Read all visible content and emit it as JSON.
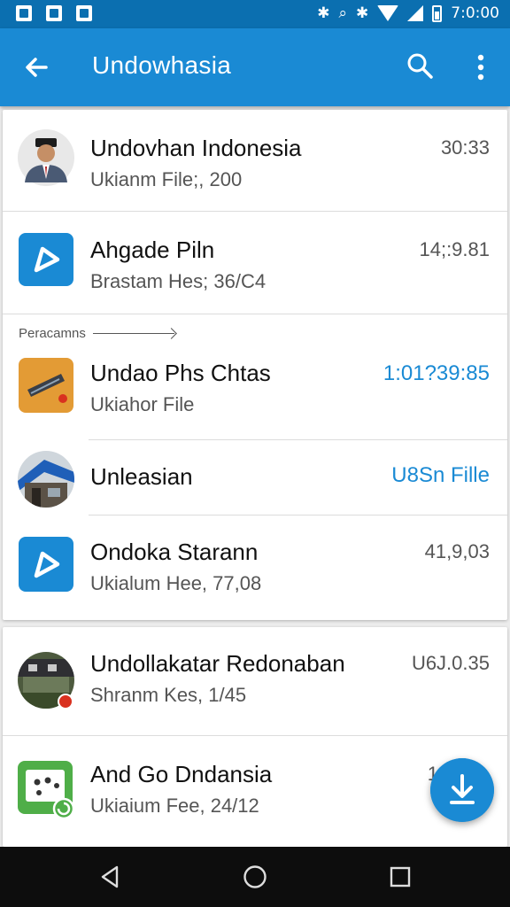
{
  "status_bar": {
    "time": "7:0:00",
    "icons": [
      "notification-icon",
      "notification-icon",
      "notification-icon",
      "bluetooth-icon",
      "vibrate-icon",
      "bluetooth-icon",
      "wifi-icon",
      "signal-icon",
      "battery-icon"
    ]
  },
  "app_bar": {
    "title": "Undowhasia",
    "back_icon": "arrow-back-icon",
    "search_icon": "search-icon",
    "more_icon": "more-vert-icon"
  },
  "colors": {
    "primary": "#1a8ad4",
    "status_bar": "#0b6fb0",
    "accent_text": "#1a8ad4"
  },
  "section_label": "Peracamns",
  "conversations": [
    {
      "name": "Undovhan Indonesia",
      "subtitle": "Ukianm File;, 200",
      "time": "30:33",
      "avatar": "person-photo"
    },
    {
      "name": "Ahgade Piln",
      "subtitle": "Brastam Hes; 36/C4",
      "time": "14;:9.81",
      "avatar": "blue-app-icon"
    },
    {
      "name": "Undao Phs Chtas",
      "subtitle": "Ukiahor File",
      "time": "1:01?39:85",
      "avatar": "orange-app-icon",
      "time_accent": true
    },
    {
      "name": "Unleasian",
      "subtitle": "",
      "time": "U8Sn Fille",
      "avatar": "building-photo",
      "time_accent": true
    },
    {
      "name": "Ondoka Starann",
      "subtitle": "Ukialum Hee, 77,08",
      "time": "41,9,03",
      "avatar": "blue-app-icon"
    },
    {
      "name": "Undollakatar Redonaban",
      "subtitle": "Shranm Kes, 1/45",
      "time": "U6J.0.35",
      "avatar": "market-photo"
    },
    {
      "name": "And Go Dndansia",
      "subtitle": "Ukiaium Fee, 24/12",
      "time": "1",
      "avatar": "green-app-icon"
    }
  ],
  "fab_icon": "download-icon",
  "nav": [
    "back-nav-icon",
    "home-nav-icon",
    "recents-nav-icon"
  ]
}
